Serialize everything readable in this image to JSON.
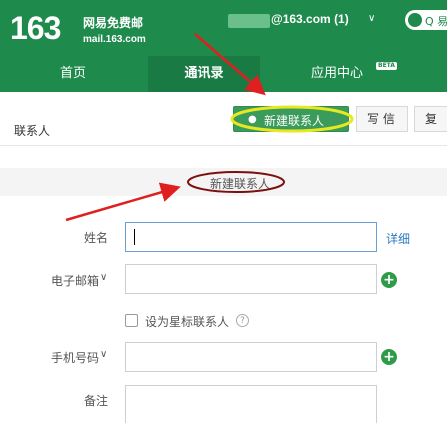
{
  "header": {
    "logo_number": "163",
    "logo_name": "网易免费邮",
    "logo_domain": "mail.163.com",
    "account": "@163.com (1)",
    "account_chevron": "∨",
    "app_pill_label": "Q 易(",
    "brand_color": "#1e8a4c"
  },
  "nav": {
    "items": [
      {
        "label": "首页"
      },
      {
        "label": "通讯录"
      },
      {
        "label": "应用中心"
      }
    ],
    "beta_badge": "BETA",
    "active_index": 1
  },
  "toolbar": {
    "breadcrumb": "联系人",
    "new_contact": "新建联系人",
    "write": "写 信",
    "more": "复"
  },
  "section": {
    "title": "新建联系人"
  },
  "form": {
    "name_label": "姓名",
    "detail_link": "详细",
    "email_label": "电子邮箱",
    "star_label": "设为星标联系人",
    "phone_label": "手机号码",
    "note_label": "备注",
    "chevron": "∨"
  }
}
